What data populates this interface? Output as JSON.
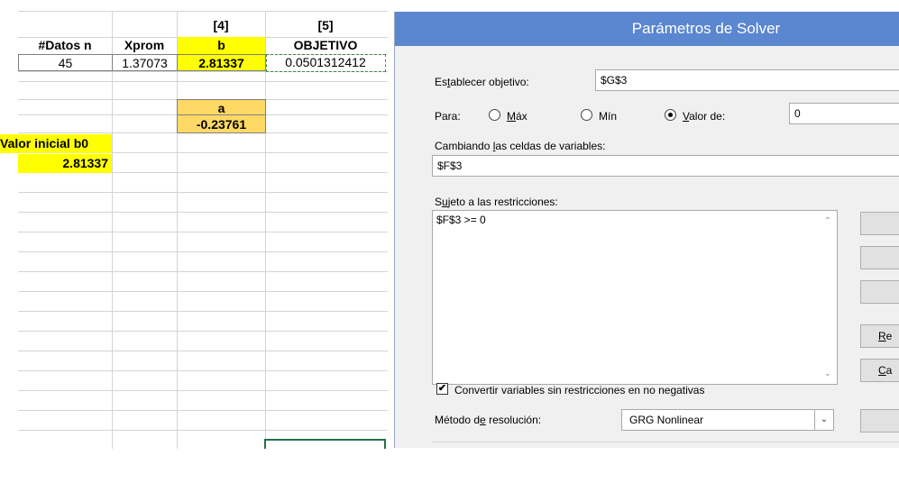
{
  "sheet": {
    "col_headers": [
      "[4]",
      "[5]"
    ],
    "headers": {
      "datos": "#Datos n",
      "xprom": "Xprom",
      "b": "b",
      "objetivo": "OBJETIVO"
    },
    "values": {
      "datos": "45",
      "xprom": "1.37073",
      "b": "2.81337",
      "objetivo": "0.0501312412"
    },
    "a_label": "a",
    "a_value": "-0.23761",
    "b0_label": "Valor inicial b0",
    "b0_value": "2.81337",
    "colors": {
      "yellow": "#ffff00",
      "tan": "#ffd966"
    }
  },
  "dialog": {
    "title": "Parámetros de Solver",
    "objective_label": "Establecer objetivo:",
    "objective_value": "$G$3",
    "para_label": "Para:",
    "radio_max": "Máx",
    "radio_min": "Mín",
    "radio_valor": "Valor de:",
    "selected_radio": "Valor de:",
    "valor_value": "0",
    "changing_label": "Cambiando las celdas de variables:",
    "changing_value": "$F$3",
    "constraints_label": "Sujeto a las restricciones:",
    "constraints": [
      "$F$3 >= 0"
    ],
    "checkbox_label": "Convertir variables sin restricciones en no negativas",
    "checkbox_checked": true,
    "method_label": "Método de resolución:",
    "method_value": "GRG Nonlinear",
    "side_buttons": [
      "Re",
      "Ca"
    ],
    "title_bar_color": "#5b86d0"
  }
}
